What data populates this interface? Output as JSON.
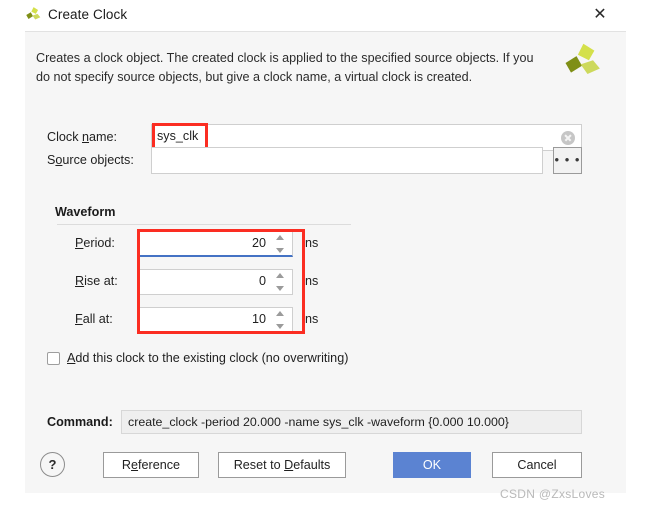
{
  "window": {
    "title": "Create Clock",
    "icon": "vivado-logo-icon",
    "close_label": "✕"
  },
  "banner": {
    "description": "Creates a clock object. The created clock is applied to the specified source objects. If you do not specify source objects, but give a clock name, a virtual clock is created.",
    "logo": "vivado-logo-icon"
  },
  "form": {
    "clock_name": {
      "label_pre": "Clock ",
      "label_mnemonic": "n",
      "label_post": "ame:",
      "value": "sys_clk",
      "placeholder": "",
      "clear_icon": "clear-circle-icon"
    },
    "source_objects": {
      "label_pre": "S",
      "label_mnemonic": "o",
      "label_post": "urce objects:",
      "value": "",
      "placeholder": "",
      "browse_label": "• • •"
    }
  },
  "waveform": {
    "title": "Waveform",
    "unit": "ns",
    "fields": [
      {
        "label_pre": "",
        "label_mnemonic": "P",
        "label_post": "eriod:",
        "value": "20",
        "focused": true
      },
      {
        "label_pre": "",
        "label_mnemonic": "R",
        "label_post": "ise at:",
        "value": "0",
        "focused": false
      },
      {
        "label_pre": "",
        "label_mnemonic": "F",
        "label_post": "all at:",
        "value": "10",
        "focused": false
      }
    ]
  },
  "options": {
    "add_clock": {
      "checked": false,
      "label_pre": "",
      "label_mnemonic": "A",
      "label_post": "dd this clock to the existing clock (no overwriting)"
    }
  },
  "command": {
    "label": "Command:",
    "value": "create_clock -period 20.000 -name sys_clk -waveform {0.000 10.000}"
  },
  "footer": {
    "help_label": "?",
    "buttons": [
      {
        "name": "reference",
        "pre": "R",
        "mn": "e",
        "post": "ference",
        "primary": false
      },
      {
        "name": "reset-to-defaults",
        "pre": "Reset to ",
        "mn": "D",
        "post": "efaults",
        "primary": false
      },
      {
        "name": "ok",
        "pre": "OK",
        "mn": "",
        "post": "",
        "primary": true
      },
      {
        "name": "cancel",
        "pre": "Cancel",
        "mn": "",
        "post": "",
        "primary": false
      }
    ]
  },
  "watermark": {
    "text": "CSDN @ZxsLoves"
  },
  "colors": {
    "accent_blue": "#5b83d2",
    "focus_blue": "#4472c4",
    "annotation_red": "#fb2d22",
    "logo_light": "#d4e04a",
    "logo_dark": "#7f8f16",
    "panel_bg": "#f6f6f6"
  }
}
